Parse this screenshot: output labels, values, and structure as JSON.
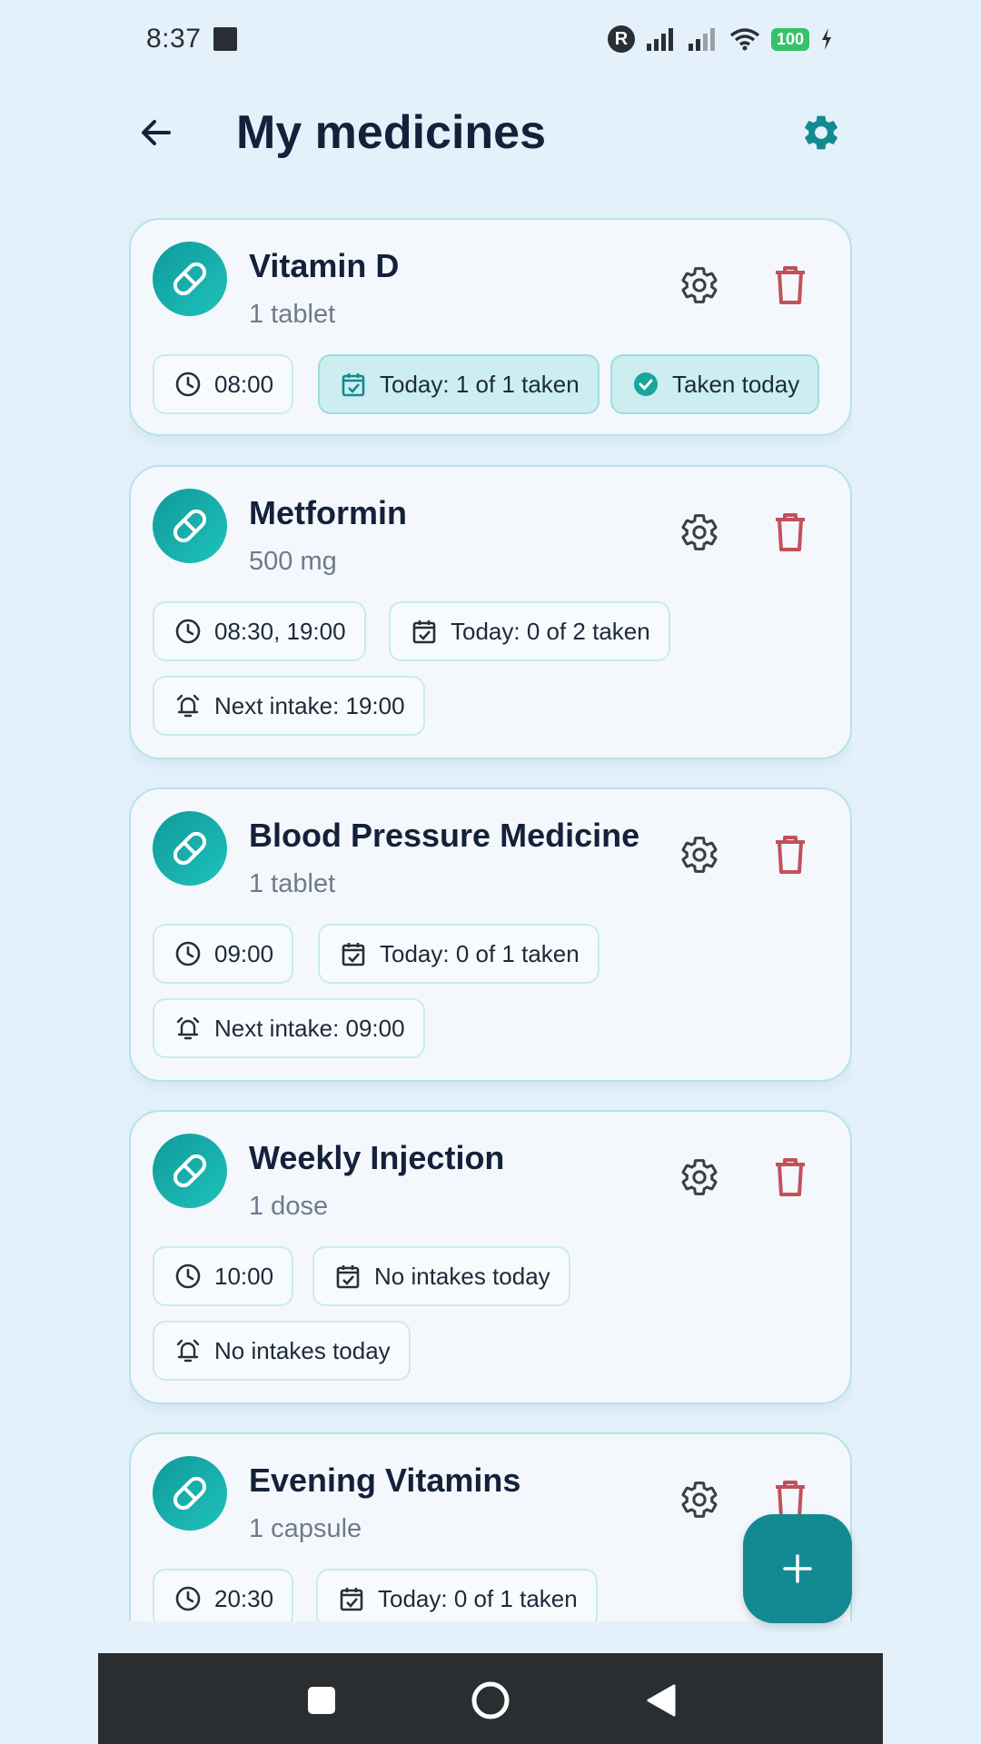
{
  "status_bar": {
    "time": "8:37",
    "r_badge": "R",
    "battery": "100"
  },
  "header": {
    "title": "My medicines"
  },
  "medicines": [
    {
      "name": "Vitamin D",
      "dose": "1 tablet",
      "times": "08:00",
      "today": "Today: 1 of 1 taken",
      "status": "Taken today"
    },
    {
      "name": "Metformin",
      "dose": "500 mg",
      "times": "08:30, 19:00",
      "today": "Today: 0 of 2 taken",
      "next": "Next intake: 19:00"
    },
    {
      "name": "Blood Pressure Medicine",
      "dose": "1 tablet",
      "times": "09:00",
      "today": "Today: 0 of 1 taken",
      "next": "Next intake: 09:00"
    },
    {
      "name": "Weekly Injection",
      "dose": "1 dose",
      "times": "10:00",
      "today": "No intakes today",
      "next": "No intakes today"
    },
    {
      "name": "Evening Vitamins",
      "dose": "1 capsule",
      "times": "20:30",
      "today": "Today: 0 of 1 taken"
    }
  ],
  "colors": {
    "accent": "#138a92",
    "danger": "#c2505a",
    "background": "#e4f1fb"
  },
  "icons": {
    "back": "arrow-left-icon",
    "settings": "gear-icon",
    "delete": "trash-icon",
    "pill": "pill-icon",
    "clock": "clock-icon",
    "calendar": "calendar-check-icon",
    "alarm": "alarm-bell-icon",
    "check": "check-circle-icon",
    "add": "plus-icon"
  }
}
